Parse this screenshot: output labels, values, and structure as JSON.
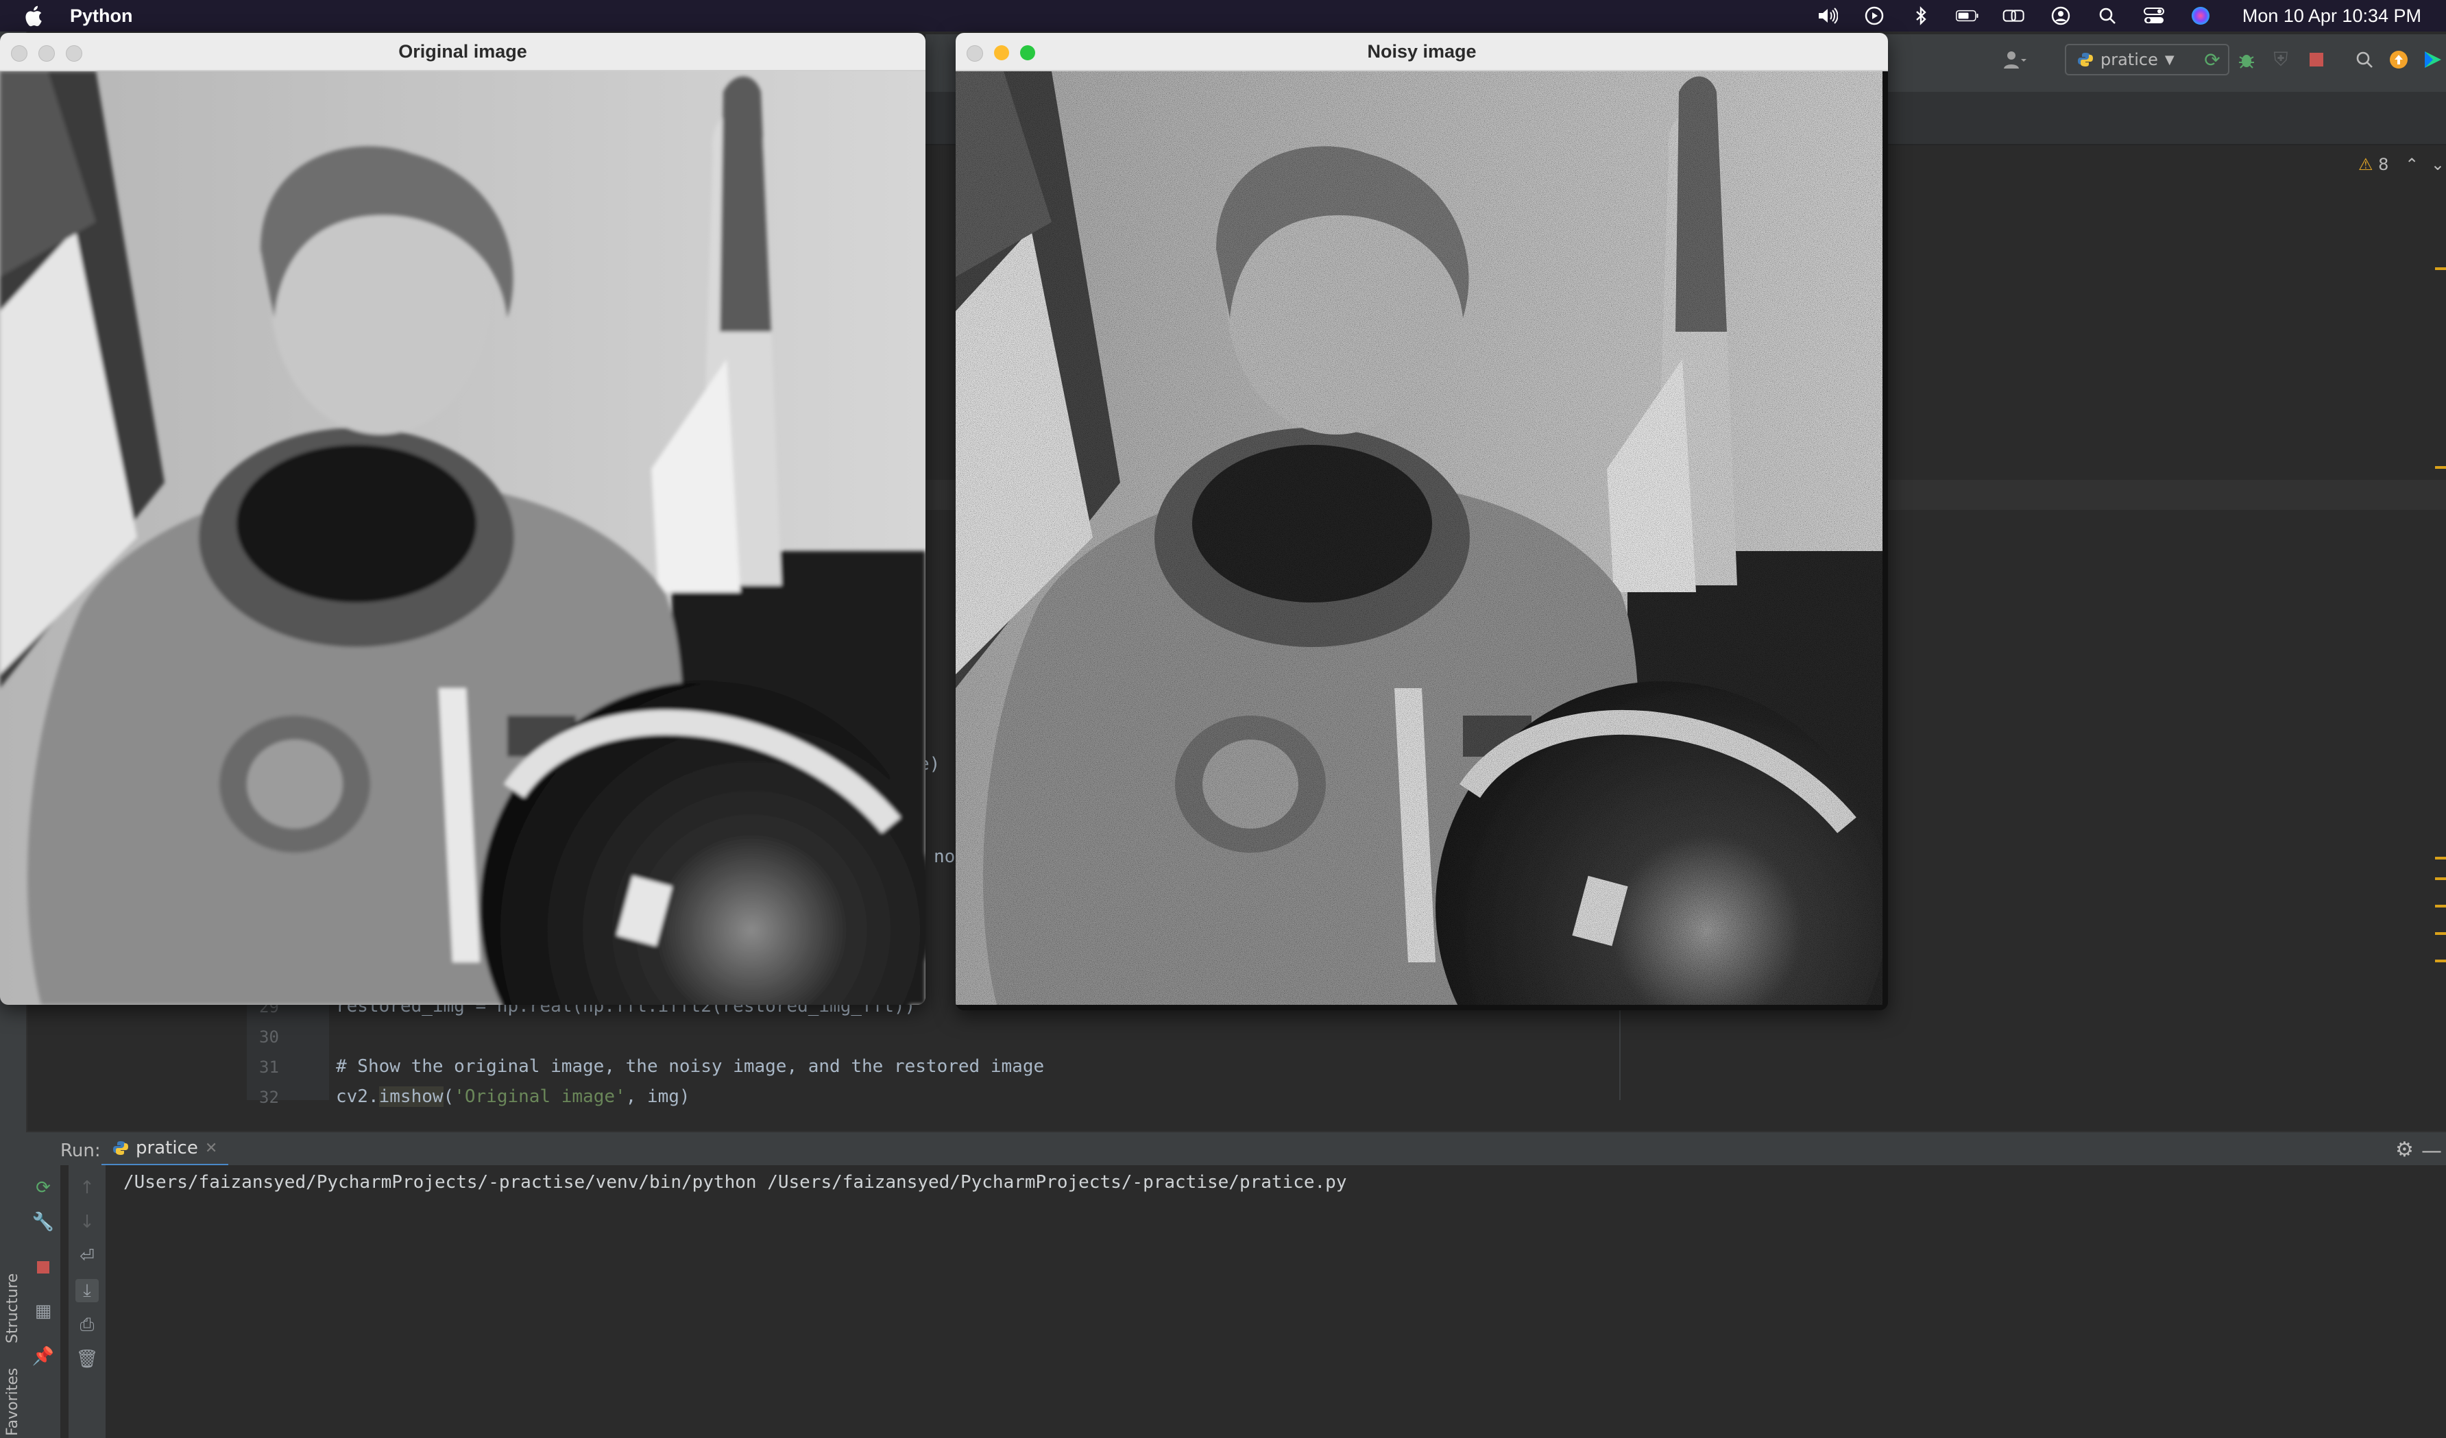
{
  "menubar": {
    "app_name": "Python",
    "clock": "Mon 10 Apr  10:34 PM",
    "icons": [
      "volume-icon",
      "play-icon",
      "bluetooth-icon",
      "battery-icon",
      "screen-mirror-icon",
      "user-icon",
      "search-icon",
      "control-center-icon",
      "siri-icon"
    ]
  },
  "ide": {
    "run_config": "pratice",
    "warnings_count": "8",
    "editor": {
      "lines": [
        {
          "num": "29",
          "text": "restored_img = np.real(np.fft.ifft2(restored_img_fft))"
        },
        {
          "num": "30",
          "text": ""
        },
        {
          "num": "31",
          "text": "# Show the original image, the noisy image, and the restored image"
        },
        {
          "num": "32",
          "text_a": "cv2.",
          "text_hl": "imshow",
          "text_b": "(",
          "text_str": "'Original image'",
          "text_c": ", img)"
        }
      ],
      "peek_1": "e)",
      "peek_2": "no"
    },
    "side_labels": {
      "structure": "Structure",
      "favorites": "Favorites"
    }
  },
  "run_panel": {
    "label": "Run:",
    "tab": "pratice",
    "console_line": "/Users/faizansyed/PycharmProjects/-practise/venv/bin/python /Users/faizansyed/PycharmProjects/-practise/pratice.py"
  },
  "windows": {
    "original": {
      "title": "Original image"
    },
    "noisy": {
      "title": "Noisy image"
    }
  },
  "colors": {
    "menubar_bg": "#1e1a2e",
    "ide_bg": "#2b2b2b",
    "traffic_red": "#ff5f57",
    "traffic_yellow": "#febc2e",
    "traffic_green": "#28c840",
    "accent_blue": "#4a88c7"
  }
}
